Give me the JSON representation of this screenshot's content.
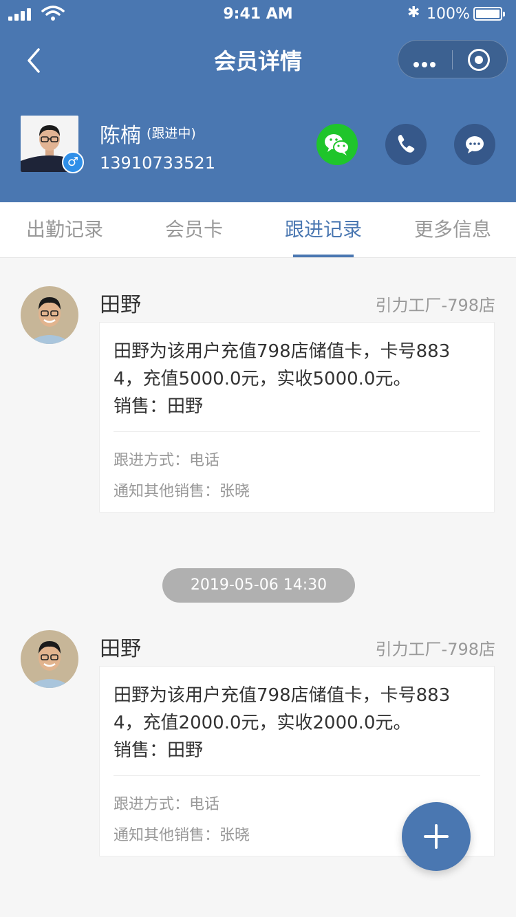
{
  "status_bar": {
    "time": "9:41 AM",
    "battery": "100%",
    "battery_level": 1.0
  },
  "nav": {
    "title": "会员详情"
  },
  "member": {
    "name": "陈楠",
    "status": "(跟进中)",
    "phone": "13910733521",
    "gender_symbol": "♂"
  },
  "colors": {
    "header": "#4a77b1",
    "wechat": "#1fc52b",
    "dark_button": "#36588a",
    "active_tab": "#4a77b1"
  },
  "icons": {
    "back": "chevron-left-icon",
    "more": "more-dots-icon",
    "close": "target-icon",
    "wechat": "wechat-icon",
    "phone": "phone-icon",
    "message": "message-icon",
    "add": "plus-icon"
  },
  "tabs": [
    {
      "label": "出勤记录",
      "active": false
    },
    {
      "label": "会员卡",
      "active": false
    },
    {
      "label": "跟进记录",
      "active": true
    },
    {
      "label": "更多信息",
      "active": false
    }
  ],
  "records": [
    {
      "name": "田野",
      "store": "引力工厂-798店",
      "lines": [
        "田野为该用户充值798店储值卡，卡号883",
        "4，充值5000.0元，实收5000.0元。",
        "销售：田野"
      ],
      "method": "跟进方式：电话",
      "notify": "通知其他销售：张晓"
    },
    {
      "name": "田野",
      "store": "引力工厂-798店",
      "lines": [
        "田野为该用户充值798店储值卡，卡号883",
        "4，充值2000.0元，实收2000.0元。",
        "销售：田野"
      ],
      "method": "跟进方式：电话",
      "notify": "通知其他销售：张晓"
    }
  ],
  "date_separator": "2019-05-06   14:30"
}
